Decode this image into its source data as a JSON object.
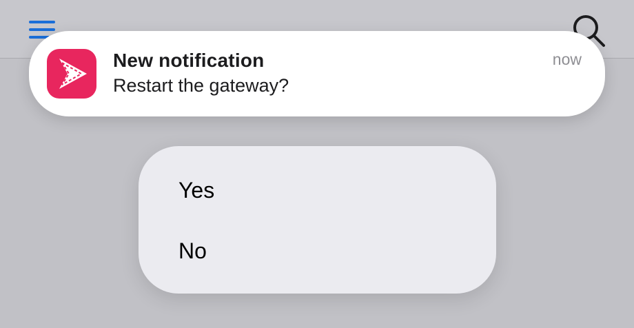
{
  "app_bar": {
    "menu_icon": "hamburger-menu-icon",
    "search_icon": "search-icon",
    "accent_color": "#1a6ed8"
  },
  "notification": {
    "app_icon": "play-arrow-icon",
    "app_icon_color": "#e8265e",
    "title": "New notification",
    "body": "Restart the gateway?",
    "time": "now"
  },
  "action_menu": {
    "options": [
      {
        "label": "Yes"
      },
      {
        "label": "No"
      }
    ]
  }
}
